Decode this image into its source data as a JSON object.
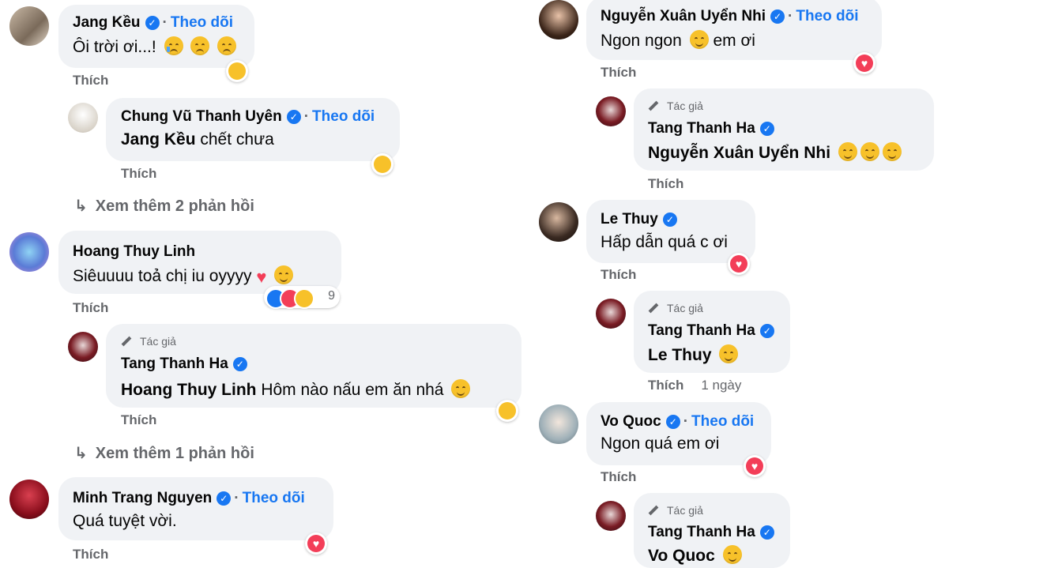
{
  "labels": {
    "follow": "Theo dõi",
    "like": "Thích",
    "author": "Tác giả"
  },
  "left": {
    "c1": {
      "name": "Jang Kều",
      "text": "Ôi trời ơi...!"
    },
    "r1": {
      "name": "Chung Vũ Thanh Uyên",
      "mention": "Jang Kều",
      "text": "chết chưa"
    },
    "more1": "Xem thêm 2 phản hồi",
    "c2": {
      "name": "Hoang Thuy Linh",
      "text": "Siêuuuu toả chị iu oyyyy",
      "reaction_count": "9"
    },
    "r2": {
      "name": "Tang Thanh Ha",
      "mention": "Hoang Thuy Linh",
      "text": "Hôm nào nấu em ăn nhá"
    },
    "more2": "Xem thêm 1 phản hồi",
    "c3": {
      "name": "Minh Trang Nguyen",
      "text": "Quá tuyệt vời."
    }
  },
  "right": {
    "c1": {
      "name": "Nguyễn Xuân Uyển Nhi",
      "text": "Ngon ngon",
      "text2": "em ơi"
    },
    "r1": {
      "name": "Tang Thanh Ha",
      "mention": "Nguyễn Xuân Uyển Nhi"
    },
    "c2": {
      "name": "Le Thuy",
      "text": "Hấp dẫn quá c ơi"
    },
    "r2": {
      "name": "Tang Thanh Ha",
      "mention": "Le Thuy",
      "time": "1 ngày"
    },
    "c3": {
      "name": "Vo Quoc",
      "text": "Ngon quá em ơi"
    },
    "r3": {
      "name": "Tang Thanh Ha",
      "mention": "Vo Quoc"
    }
  },
  "colors": {
    "accent": "#1877f2",
    "bubble": "#f0f2f5",
    "muted": "#65676b",
    "heart": "#f33e58"
  },
  "icons": [
    "verified-badge-icon",
    "reply-arrow-icon",
    "pencil-icon",
    "heart-reaction-icon",
    "haha-reaction-icon",
    "like-reaction-icon",
    "smile-emoji-icon",
    "sad-emoji-icon"
  ]
}
